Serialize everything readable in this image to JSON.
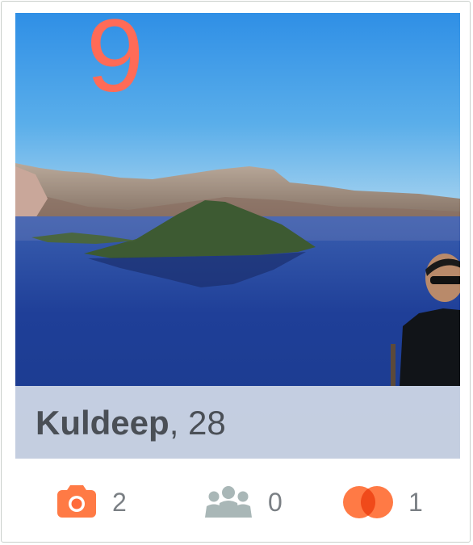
{
  "overlay_number": "9",
  "profile": {
    "name": "Kuldeep",
    "separator": ",",
    "age": "28"
  },
  "stats": {
    "photos": {
      "icon": "camera-icon",
      "count": "2"
    },
    "friends": {
      "icon": "people-icon",
      "count": "0"
    },
    "interests": {
      "icon": "overlapping-circles-icon",
      "count": "1"
    }
  },
  "colors": {
    "accent": "#ff6b57",
    "icon_orange": "#ff7a45",
    "icon_gray": "#a9b7b7",
    "name_text": "#4a4f56",
    "count_text": "#7a7f84",
    "name_bar": "#dce2ec"
  }
}
